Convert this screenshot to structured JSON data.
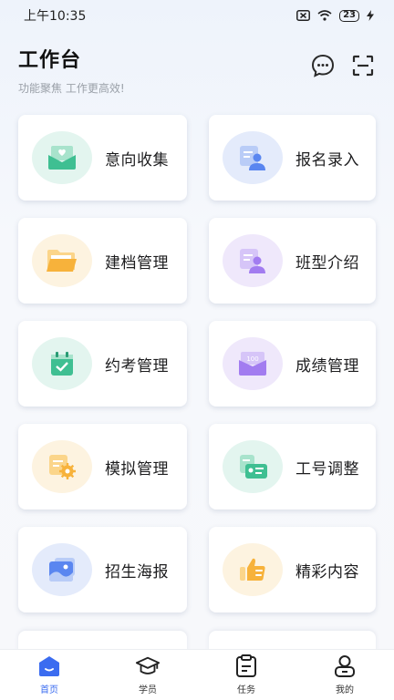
{
  "status_bar": {
    "time": "上午10:35",
    "battery": "23"
  },
  "header": {
    "title": "工作台",
    "subtitle": "功能聚焦 工作更高效!"
  },
  "cards": [
    {
      "label": "意向收集",
      "icon": "envelope-heart-icon",
      "bg": "#e3f5ef"
    },
    {
      "label": "报名录入",
      "icon": "user-form-icon",
      "bg": "#e4ebfb"
    },
    {
      "label": "建档管理",
      "icon": "folder-icon",
      "bg": "#fdf3e0"
    },
    {
      "label": "班型介绍",
      "icon": "user-card-icon",
      "bg": "#efe8fb"
    },
    {
      "label": "约考管理",
      "icon": "calendar-check-icon",
      "bg": "#e3f5ef"
    },
    {
      "label": "成绩管理",
      "icon": "score-folder-icon",
      "bg": "#efe8fb"
    },
    {
      "label": "模拟管理",
      "icon": "doc-gear-icon",
      "bg": "#fdf3e0"
    },
    {
      "label": "工号调整",
      "icon": "id-card-icon",
      "bg": "#e3f5ef"
    },
    {
      "label": "招生海报",
      "icon": "poster-image-icon",
      "bg": "#e4ebfb"
    },
    {
      "label": "精彩内容",
      "icon": "thumbs-up-icon",
      "bg": "#fdf3e0"
    }
  ],
  "nav": [
    {
      "label": "首页",
      "icon": "home-icon",
      "active": true
    },
    {
      "label": "学员",
      "icon": "graduation-cap-icon",
      "active": false
    },
    {
      "label": "任务",
      "icon": "task-clipboard-icon",
      "active": false
    },
    {
      "label": "我的",
      "icon": "profile-icon",
      "active": false
    }
  ],
  "colors": {
    "accent": "#3b6cf0",
    "green": "#3fbf92",
    "blue": "#5a86f0",
    "orange": "#f7b23b",
    "purple": "#a27cf0"
  }
}
